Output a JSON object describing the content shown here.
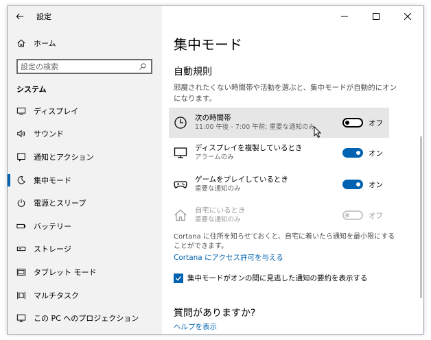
{
  "window": {
    "title": "設定"
  },
  "sidebar": {
    "back_label": "←",
    "home_label": "ホーム",
    "search": {
      "placeholder": "設定の検索",
      "value": ""
    },
    "section_title": "システム",
    "items": [
      {
        "label": "ディスプレイ",
        "icon": "display-icon"
      },
      {
        "label": "サウンド",
        "icon": "speaker-icon"
      },
      {
        "label": "通知とアクション",
        "icon": "notification-icon"
      },
      {
        "label": "集中モード",
        "icon": "moon-icon",
        "selected": true
      },
      {
        "label": "電源とスリープ",
        "icon": "power-icon"
      },
      {
        "label": "バッテリー",
        "icon": "battery-icon"
      },
      {
        "label": "ストレージ",
        "icon": "storage-icon"
      },
      {
        "label": "タブレット モード",
        "icon": "tablet-icon"
      },
      {
        "label": "マルチタスク",
        "icon": "multitask-icon"
      },
      {
        "label": "この PC へのプロジェクション",
        "icon": "projection-icon"
      }
    ]
  },
  "main": {
    "page_title": "集中モード",
    "section_title": "自動規則",
    "description": "邪魔されたくない時間帯や活動を選ぶと、集中モードが自動的にオンになります。",
    "rules": [
      {
        "name": "次の時間帯",
        "sub": "11:00 午後 - 7:00 午前; 重要な通知のみ",
        "state": "オフ",
        "on": false,
        "disabled": false,
        "icon": "clock-icon"
      },
      {
        "name": "ディスプレイを複製しているとき",
        "sub": "アラームのみ",
        "state": "オン",
        "on": true,
        "disabled": false,
        "icon": "monitor-icon"
      },
      {
        "name": "ゲームをプレイしているとき",
        "sub": "重要な通知のみ",
        "state": "オン",
        "on": true,
        "disabled": false,
        "icon": "gamepad-icon"
      },
      {
        "name": "自宅にいるとき",
        "sub": "重要な通知のみ",
        "state": "オフ",
        "on": false,
        "disabled": true,
        "icon": "home-icon"
      }
    ],
    "cortana_text": "Cortana に住所を知らせておくと、自宅に着いたら通知を最小限にすることができます。",
    "cortana_link": "Cortana にアクセス許可を与える",
    "checkbox_label": "集中モードがオンの間に見逃した通知の要約を表示する",
    "checkbox_checked": true,
    "qa_title": "質問がありますか?",
    "qa_link": "ヘルプを表示"
  },
  "colors": {
    "accent": "#0063b1",
    "sidebar_bg": "#f2f2f2",
    "hover_bg": "#e6e6e6"
  }
}
